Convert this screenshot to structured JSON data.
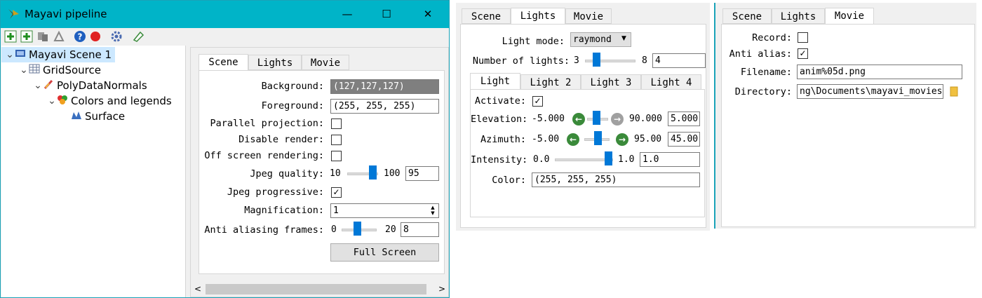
{
  "window": {
    "title": "Mayavi pipeline",
    "controls": {
      "minimize": "—",
      "maximize": "☐",
      "close": "✕"
    }
  },
  "toolbar": {
    "icons": [
      "add-source-icon",
      "add-filter-icon",
      "add-module-icon",
      "remove-icon",
      "help-icon",
      "record-icon",
      "settings-icon",
      "edit-icon"
    ]
  },
  "tree": [
    {
      "label": "Mayavi Scene 1",
      "icon": "scene-icon",
      "expanded": true,
      "level": 0,
      "selected": true
    },
    {
      "label": "GridSource",
      "icon": "grid-icon",
      "expanded": true,
      "level": 1
    },
    {
      "label": "PolyDataNormals",
      "icon": "filter-icon",
      "expanded": true,
      "level": 2
    },
    {
      "label": "Colors and legends",
      "icon": "colors-icon",
      "expanded": true,
      "level": 3
    },
    {
      "label": "Surface",
      "icon": "surface-icon",
      "level": 4
    }
  ],
  "scene_panel": {
    "tabs": [
      "Scene",
      "Lights",
      "Movie"
    ],
    "active_tab": "Scene",
    "background_label": "Background:",
    "background_value": "(127,127,127)",
    "foreground_label": "Foreground:",
    "foreground_value": "(255, 255, 255)",
    "parallel_label": "Parallel projection:",
    "disable_render_label": "Disable render:",
    "offscreen_label": "Off screen rendering:",
    "jpeg_quality_label": "Jpeg quality:",
    "jpeg_quality_min": "10",
    "jpeg_quality_max": "100",
    "jpeg_quality_value": "95",
    "jpeg_progressive_label": "Jpeg progressive:",
    "magnification_label": "Magnification:",
    "magnification_value": "1",
    "anti_alias_label": "Anti aliasing frames:",
    "anti_alias_min": "0",
    "anti_alias_max": "20",
    "anti_alias_value": "8",
    "full_screen_label": "Full Screen",
    "check": "✓"
  },
  "lights_panel": {
    "tabs": [
      "Scene",
      "Lights",
      "Movie"
    ],
    "active_tab": "Lights",
    "light_mode_label": "Light mode:",
    "light_mode_value": "raymond",
    "num_lights_label": "Number of lights:",
    "num_lights_min": "3",
    "num_lights_max": "8",
    "num_lights_value": "4",
    "light_tabs": [
      "Light",
      "Light 2",
      "Light 3",
      "Light 4"
    ],
    "activate_label": "Activate:",
    "elevation_label": "Elevation:",
    "elevation_min": "-5.000",
    "elevation_max": "90.000",
    "elevation_value": "5.000",
    "azimuth_label": "Azimuth:",
    "azimuth_min": "-5.00",
    "azimuth_max": "95.00",
    "azimuth_value": "45.00",
    "intensity_label": "Intensity:",
    "intensity_min": "0.0",
    "intensity_max": "1.0",
    "intensity_value": "1.0",
    "color_label": "Color:",
    "color_value": "(255, 255, 255)",
    "check": "✓"
  },
  "movie_panel": {
    "tabs": [
      "Scene",
      "Lights",
      "Movie"
    ],
    "active_tab": "Movie",
    "record_label": "Record:",
    "anti_alias_label": "Anti alias:",
    "filename_label": "Filename:",
    "filename_value": "anim%05d.png",
    "directory_label": "Directory:",
    "directory_value": "ng\\Documents\\mayavi_movies",
    "check": "✓"
  },
  "colors": {
    "titlebar": "#00b4c8",
    "slider_thumb": "#0078d7",
    "background_swatch": "#7f7f7f"
  }
}
